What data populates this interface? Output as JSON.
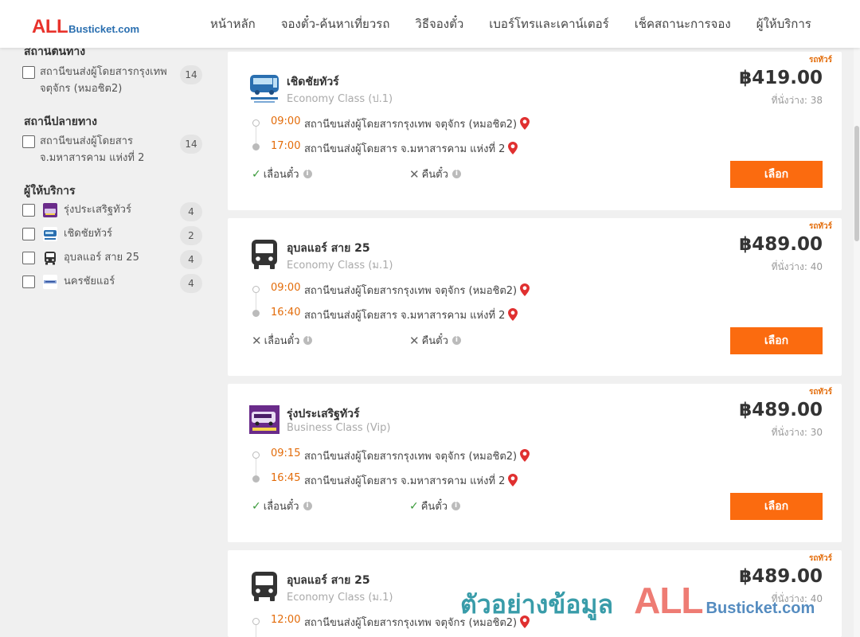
{
  "header": {
    "logo_all": "ALL",
    "logo_rest": "Busticket.com",
    "nav": [
      "หน้าหลัก",
      "จองตั๋ว-ค้นหาเที่ยวรถ",
      "วิธีจองตั๋ว",
      "เบอร์โทรและเคาน์เตอร์",
      "เช็คสถานะการจอง",
      "ผู้ให้บริการ"
    ]
  },
  "sidebar": {
    "origin_title": "สถานีต้นทาง",
    "origin_items": [
      {
        "label": "สถานีขนส่งผู้โดยสารกรุงเทพ จตุจักร (หมอชิต2)",
        "count": "14"
      }
    ],
    "dest_title": "สถานีปลายทาง",
    "dest_items": [
      {
        "label": "สถานีขนส่งผู้โดยสาร จ.มหาสารคาม แห่งที่ 2",
        "count": "14"
      }
    ],
    "operator_title": "ผู้ให้บริการ",
    "operators": [
      {
        "name": "รุ่งประเสริฐทัวร์",
        "count": "4",
        "logo": "rungprasert-logo"
      },
      {
        "name": "เชิดชัยทัวร์",
        "count": "2",
        "logo": "cherdchai-logo"
      },
      {
        "name": "อุบลแอร์ สาย 25",
        "count": "4",
        "logo": "bus-icon"
      },
      {
        "name": "นครชัยแอร์",
        "count": "4",
        "logo": "nakhonchai-logo"
      }
    ]
  },
  "trips": [
    {
      "tag": "รถทัวร์",
      "operator": "เชิดชัยทัวร์",
      "bus_class": "Economy Class (ป.1)",
      "price": "฿419.00",
      "seats": "ที่นั่งว่าง: 38",
      "depart_time": "09:00",
      "depart_station": "สถานีขนส่งผู้โดยสารกรุงเทพ จตุจักร (หมอชิต2)",
      "arrive_time": "17:00",
      "arrive_station": "สถานีขนส่งผู้โดยสาร จ.มหาสารคาม แห่งที่ 2",
      "postpone_label": "เลื่อนตั๋ว",
      "postpone_ok": true,
      "refund_label": "คืนตั๋ว",
      "refund_ok": false,
      "select_label": "เลือก",
      "logo": "cherdchai-logo"
    },
    {
      "tag": "รถทัวร์",
      "operator": "อุบลแอร์ สาย 25",
      "bus_class": "Economy Class (ม.1)",
      "price": "฿489.00",
      "seats": "ที่นั่งว่าง: 40",
      "depart_time": "09:00",
      "depart_station": "สถานีขนส่งผู้โดยสารกรุงเทพ จตุจักร (หมอชิต2)",
      "arrive_time": "16:40",
      "arrive_station": "สถานีขนส่งผู้โดยสาร จ.มหาสารคาม แห่งที่ 2",
      "postpone_label": "เลื่อนตั๋ว",
      "postpone_ok": false,
      "refund_label": "คืนตั๋ว",
      "refund_ok": false,
      "select_label": "เลือก",
      "logo": "bus-icon"
    },
    {
      "tag": "รถทัวร์",
      "operator": "รุ่งประเสริฐทัวร์",
      "bus_class": "Business Class (Vip)",
      "price": "฿489.00",
      "seats": "ที่นั่งว่าง: 30",
      "depart_time": "09:15",
      "depart_station": "สถานีขนส่งผู้โดยสารกรุงเทพ จตุจักร (หมอชิต2)",
      "arrive_time": "16:45",
      "arrive_station": "สถานีขนส่งผู้โดยสาร จ.มหาสารคาม แห่งที่ 2",
      "postpone_label": "เลื่อนตั๋ว",
      "postpone_ok": true,
      "refund_label": "คืนตั๋ว",
      "refund_ok": true,
      "select_label": "เลือก",
      "logo": "rungprasert-logo"
    },
    {
      "tag": "รถทัวร์",
      "operator": "อุบลแอร์ สาย 25",
      "bus_class": "Economy Class (ม.1)",
      "price": "฿489.00",
      "seats": "ที่นั่งว่าง: 40",
      "depart_time": "12:00",
      "depart_station": "สถานีขนส่งผู้โดยสารกรุงเทพ จตุจักร (หมอชิต2)",
      "logo": "bus-icon"
    }
  ],
  "watermark": {
    "thai": "ตัวอย่างข้อมูล",
    "all": "ALL",
    "rest": "Busticket.com"
  },
  "colors": {
    "accent": "#fb6b0f",
    "time": "#e36c0a",
    "ok": "#3a9a3a",
    "pin": "#e03030"
  }
}
